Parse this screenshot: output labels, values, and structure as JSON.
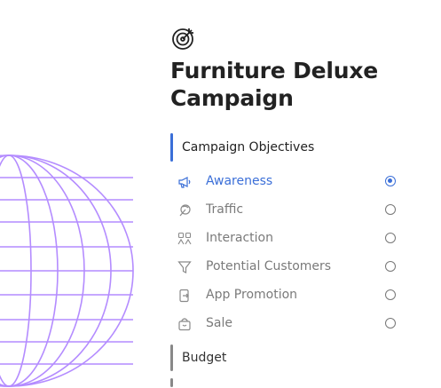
{
  "campaign": {
    "title_line1": "Furniture Deluxe",
    "title_line2": "Campaign",
    "icon": "target-icon"
  },
  "sections": {
    "objectives_label": "Campaign Objectives",
    "budget_label": "Budget"
  },
  "objectives": [
    {
      "label": "Awareness",
      "icon": "megaphone-icon",
      "selected": true
    },
    {
      "label": "Traffic",
      "icon": "cursor-icon",
      "selected": false
    },
    {
      "label": "Interaction",
      "icon": "people-icon",
      "selected": false
    },
    {
      "label": "Potential Customers",
      "icon": "filter-icon",
      "selected": false
    },
    {
      "label": "App Promotion",
      "icon": "phone-icon",
      "selected": false
    },
    {
      "label": "Sale",
      "icon": "shopping-bag-icon",
      "selected": false
    }
  ],
  "colors": {
    "accent": "#3b6fd8",
    "globe": "#b48cff",
    "muted": "#7a7a7a"
  }
}
